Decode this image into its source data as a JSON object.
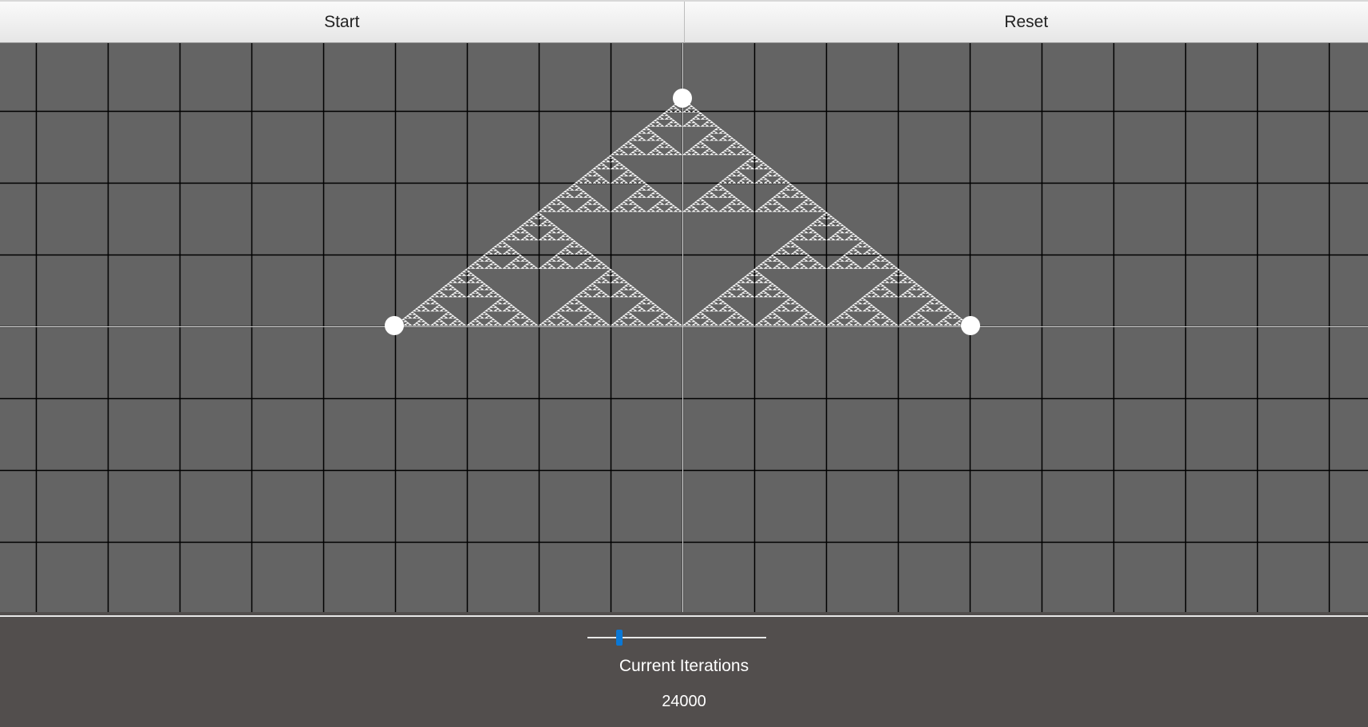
{
  "toolbar": {
    "start_label": "Start",
    "reset_label": "Reset"
  },
  "canvas": {
    "background": "#646464",
    "grid_color": "#000000",
    "axis_color": "#d9d9d9",
    "fractal_color": "#ffffff",
    "fractal": "sierpinski-triangle",
    "vertices": 3
  },
  "controls": {
    "iterations_label": "Current Iterations",
    "iterations_value": "24000",
    "slider_fraction": 0.18,
    "slider_accent": "#0a78d6"
  }
}
